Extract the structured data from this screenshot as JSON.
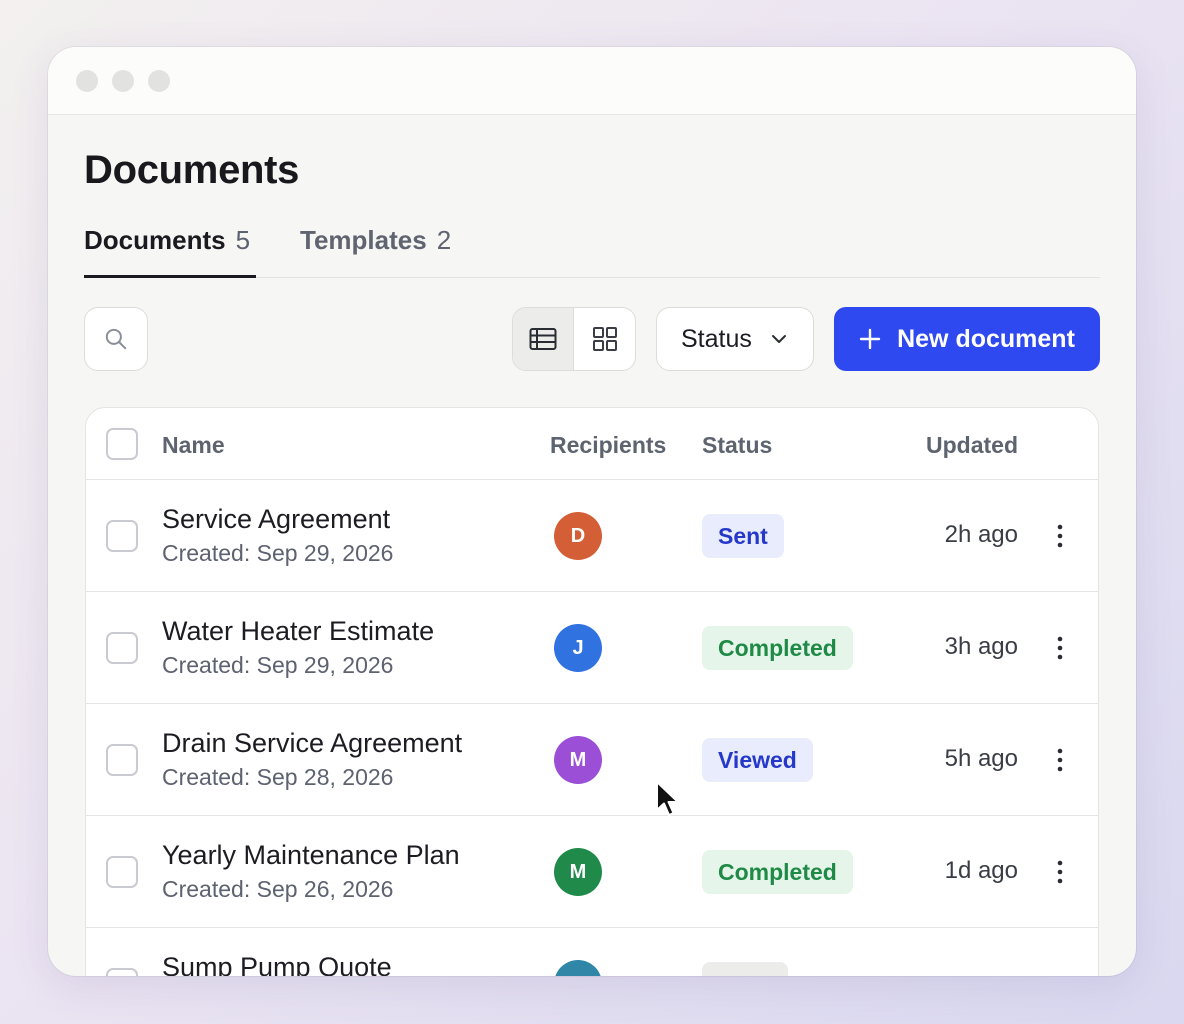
{
  "page": {
    "title": "Documents"
  },
  "tabs": [
    {
      "label": "Documents",
      "count": "5"
    },
    {
      "label": "Templates",
      "count": "2"
    }
  ],
  "toolbar": {
    "status_label": "Status",
    "new_button_label": "New document"
  },
  "table": {
    "headers": {
      "name": "Name",
      "recipients": "Recipients",
      "status": "Status",
      "updated": "Updated"
    },
    "rows": [
      {
        "name": "Service Agreement",
        "created": "Created: Sep 29, 2026",
        "recipient": "D",
        "avatar_color": "#d45f36",
        "status": "Sent",
        "badge_bg": "#e8ecfd",
        "badge_fg": "#2538c9",
        "updated": "2h ago"
      },
      {
        "name": "Water Heater Estimate",
        "created": "Created: Sep 29, 2026",
        "recipient": "J",
        "avatar_color": "#2f72e0",
        "status": "Completed",
        "badge_bg": "#e6f5ea",
        "badge_fg": "#1e8a45",
        "updated": "3h ago"
      },
      {
        "name": "Drain Service Agreement",
        "created": "Created: Sep 28, 2026",
        "recipient": "M",
        "avatar_color": "#9a4fd6",
        "status": "Viewed",
        "badge_bg": "#e8ecfd",
        "badge_fg": "#2538c9",
        "updated": "5h ago"
      },
      {
        "name": "Yearly Maintenance Plan",
        "created": "Created: Sep 26, 2026",
        "recipient": "M",
        "avatar_color": "#1f8a4a",
        "status": "Completed",
        "badge_bg": "#e6f5ea",
        "badge_fg": "#1e8a45",
        "updated": "1d ago"
      },
      {
        "name": "Sump Pump Quote",
        "created": "",
        "recipient": "",
        "avatar_color": "#2f86a6",
        "status": "",
        "badge_bg": "#ececea",
        "badge_fg": "#5d6270",
        "updated": ""
      }
    ]
  },
  "icons": {
    "search": "search-icon",
    "list_view": "list-view-icon",
    "grid_view": "grid-view-icon",
    "chevron": "chevron-down-icon",
    "plus": "plus-icon",
    "kebab": "more-vertical-icon",
    "cursor": "mouse-cursor-icon"
  }
}
